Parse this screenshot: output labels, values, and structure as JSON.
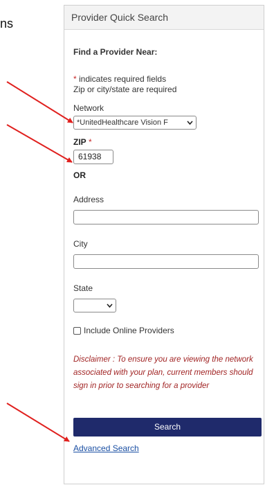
{
  "side_text": "ns",
  "panel": {
    "title": "Provider Quick Search",
    "find_label": "Find a Provider Near:",
    "required_star": "*",
    "required_note": " indicates required fields",
    "required_note2": "Zip or city/state are required",
    "network": {
      "label": "Network",
      "value": "*UnitedHealthcare Vision F"
    },
    "zip": {
      "label": "ZIP",
      "star": "*",
      "value": "61938"
    },
    "or_label": "OR",
    "address": {
      "label": "Address",
      "value": ""
    },
    "city": {
      "label": "City",
      "value": ""
    },
    "state": {
      "label": "State",
      "value": ""
    },
    "online_checkbox": {
      "label": "Include Online Providers",
      "checked": false
    },
    "disclaimer": "Disclaimer : To ensure you are viewing the network associated with your plan, current members should sign in prior to searching for a provider",
    "search_button": "Search",
    "advanced_link": "Advanced Search"
  },
  "colors": {
    "arrow": "#e0201e",
    "button": "#1f2a6b",
    "disclaimer": "#a12424",
    "link": "#1a4fa3"
  },
  "icons": {
    "select_chevron": "chevron-down-icon"
  }
}
